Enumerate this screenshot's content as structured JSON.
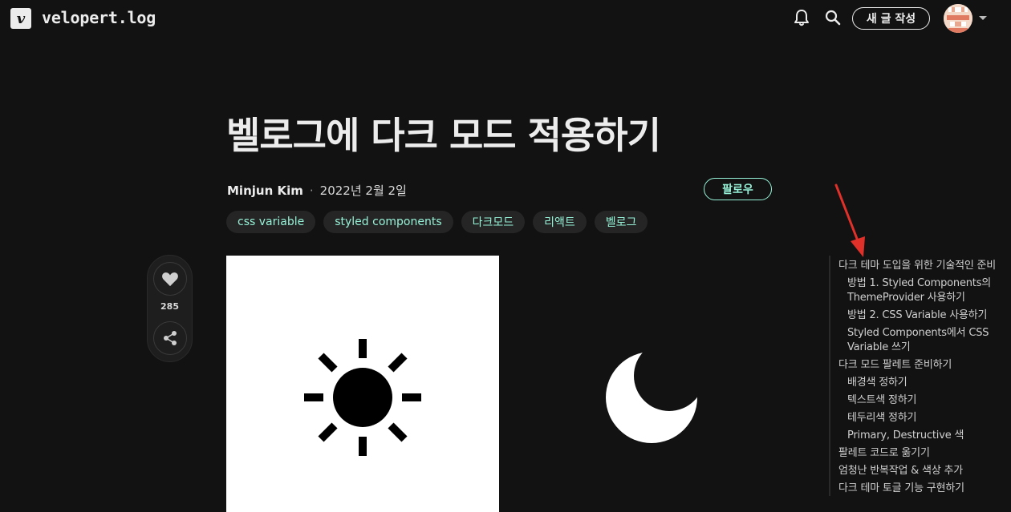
{
  "header": {
    "logo_letter": "v",
    "blog_name": "velopert.log",
    "write_label": "새 글 작성"
  },
  "post": {
    "title": "벨로그에 다크 모드 적용하기",
    "author": "Minjun Kim",
    "separator": "·",
    "date": "2022년 2월 2일",
    "follow_label": "팔로우",
    "tags": [
      "css variable",
      "styled components",
      "다크모드",
      "리액트",
      "벨로그"
    ],
    "like_count": "285"
  },
  "toc": {
    "items": [
      {
        "level": 1,
        "label": "다크 테마 도입을 위한 기술적인 준비"
      },
      {
        "level": 2,
        "label": "방법 1. Styled Components의 ThemeProvider 사용하기"
      },
      {
        "level": 2,
        "label": "방법 2. CSS Variable 사용하기"
      },
      {
        "level": 2,
        "label": "Styled Components에서 CSS Variable 쓰기"
      },
      {
        "level": 1,
        "label": "다크 모드 팔레트 준비하기"
      },
      {
        "level": 2,
        "label": "배경색 정하기"
      },
      {
        "level": 2,
        "label": "텍스트색 정하기"
      },
      {
        "level": 2,
        "label": "테두리색 정하기"
      },
      {
        "level": 2,
        "label": "Primary, Destructive 색"
      },
      {
        "level": 1,
        "label": "팔레트 코드로 옮기기"
      },
      {
        "level": 1,
        "label": "엄청난 반복작업 & 색상 추가"
      },
      {
        "level": 1,
        "label": "다크 테마 토글 기능 구현하기"
      }
    ]
  },
  "colors": {
    "background": "#121212",
    "accent_teal": "#96f2d7",
    "arrow_red": "#e0302a"
  },
  "icons": [
    "logo-icon",
    "bell-icon",
    "search-icon",
    "avatar",
    "caret-down-icon",
    "heart-icon",
    "share-icon",
    "sun-icon",
    "moon-icon"
  ]
}
